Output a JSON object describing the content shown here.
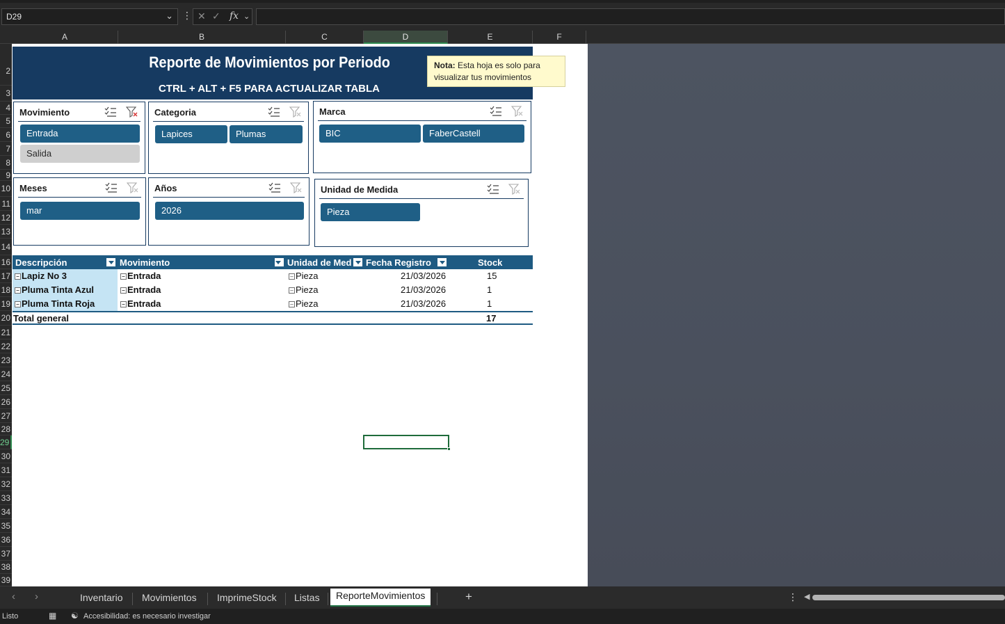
{
  "formula_bar": {
    "name_box": "D29",
    "fx_label": "fx",
    "formula": ""
  },
  "columns": [
    "A",
    "B",
    "C",
    "D",
    "E",
    "F"
  ],
  "selected_column": "D",
  "rows": [
    "2",
    "3",
    "4",
    "5",
    "6",
    "7",
    "8",
    "9",
    "10",
    "11",
    "12",
    "13",
    "14",
    "16",
    "17",
    "18",
    "19",
    "20",
    "21",
    "22",
    "23",
    "24",
    "25",
    "26",
    "27",
    "28",
    "29",
    "30",
    "31",
    "32",
    "33",
    "34",
    "35",
    "36",
    "37",
    "38",
    "39"
  ],
  "selected_row": "29",
  "banner": {
    "title": "Reporte de Movimientos por Periodo",
    "subtitle": "CTRL + ALT + F5 PARA ACTUALIZAR TABLA",
    "bg_color": "#163a61"
  },
  "note": {
    "label": "Nota:",
    "text": "Esta hoja es solo para visualizar tus movimientos"
  },
  "slicers": {
    "movimiento": {
      "title": "Movimiento",
      "items": [
        "Entrada",
        "Salida"
      ],
      "selected": [
        "Entrada"
      ],
      "filter_active": true
    },
    "categoria": {
      "title": "Categoria",
      "items": [
        "Lapices",
        "Plumas"
      ],
      "filter_active": false
    },
    "marca": {
      "title": "Marca",
      "items": [
        "BIC",
        "FaberCastell"
      ],
      "filter_active": false
    },
    "meses": {
      "title": "Meses",
      "items": [
        "mar"
      ],
      "filter_active": false
    },
    "anios": {
      "title": "Años",
      "items": [
        "2026"
      ],
      "filter_active": false
    },
    "unidad": {
      "title": "Unidad de Medida",
      "items": [
        "Pieza"
      ],
      "filter_active": false
    }
  },
  "pivot": {
    "headers": {
      "descripcion": "Descripción",
      "movimiento": "Movimiento",
      "unidad": "Unidad de Med",
      "fecha": "Fecha Registro",
      "stock": "Stock"
    },
    "rows": [
      {
        "descripcion": "Lapiz No 3",
        "movimiento": "Entrada",
        "unidad": "Pieza",
        "fecha": "21/03/2026",
        "stock": "15"
      },
      {
        "descripcion": "Pluma Tinta Azul",
        "movimiento": "Entrada",
        "unidad": "Pieza",
        "fecha": "21/03/2026",
        "stock": "1"
      },
      {
        "descripcion": "Pluma Tinta Roja",
        "movimiento": "Entrada",
        "unidad": "Pieza",
        "fecha": "21/03/2026",
        "stock": "1"
      }
    ],
    "total": {
      "label": "Total general",
      "stock": "17"
    },
    "header_color": "#1e5a82",
    "row_label_color": "#c5e4f4"
  },
  "sheet_tabs": [
    "Inventario",
    "Movimientos",
    "ImprimeStock",
    "Listas",
    "ReporteMovimientos"
  ],
  "active_tab": "ReporteMovimientos",
  "add_sheet_symbol": "+",
  "status": {
    "ready": "Listo",
    "accessibility": "Accesibilidad: es necesario investigar"
  }
}
